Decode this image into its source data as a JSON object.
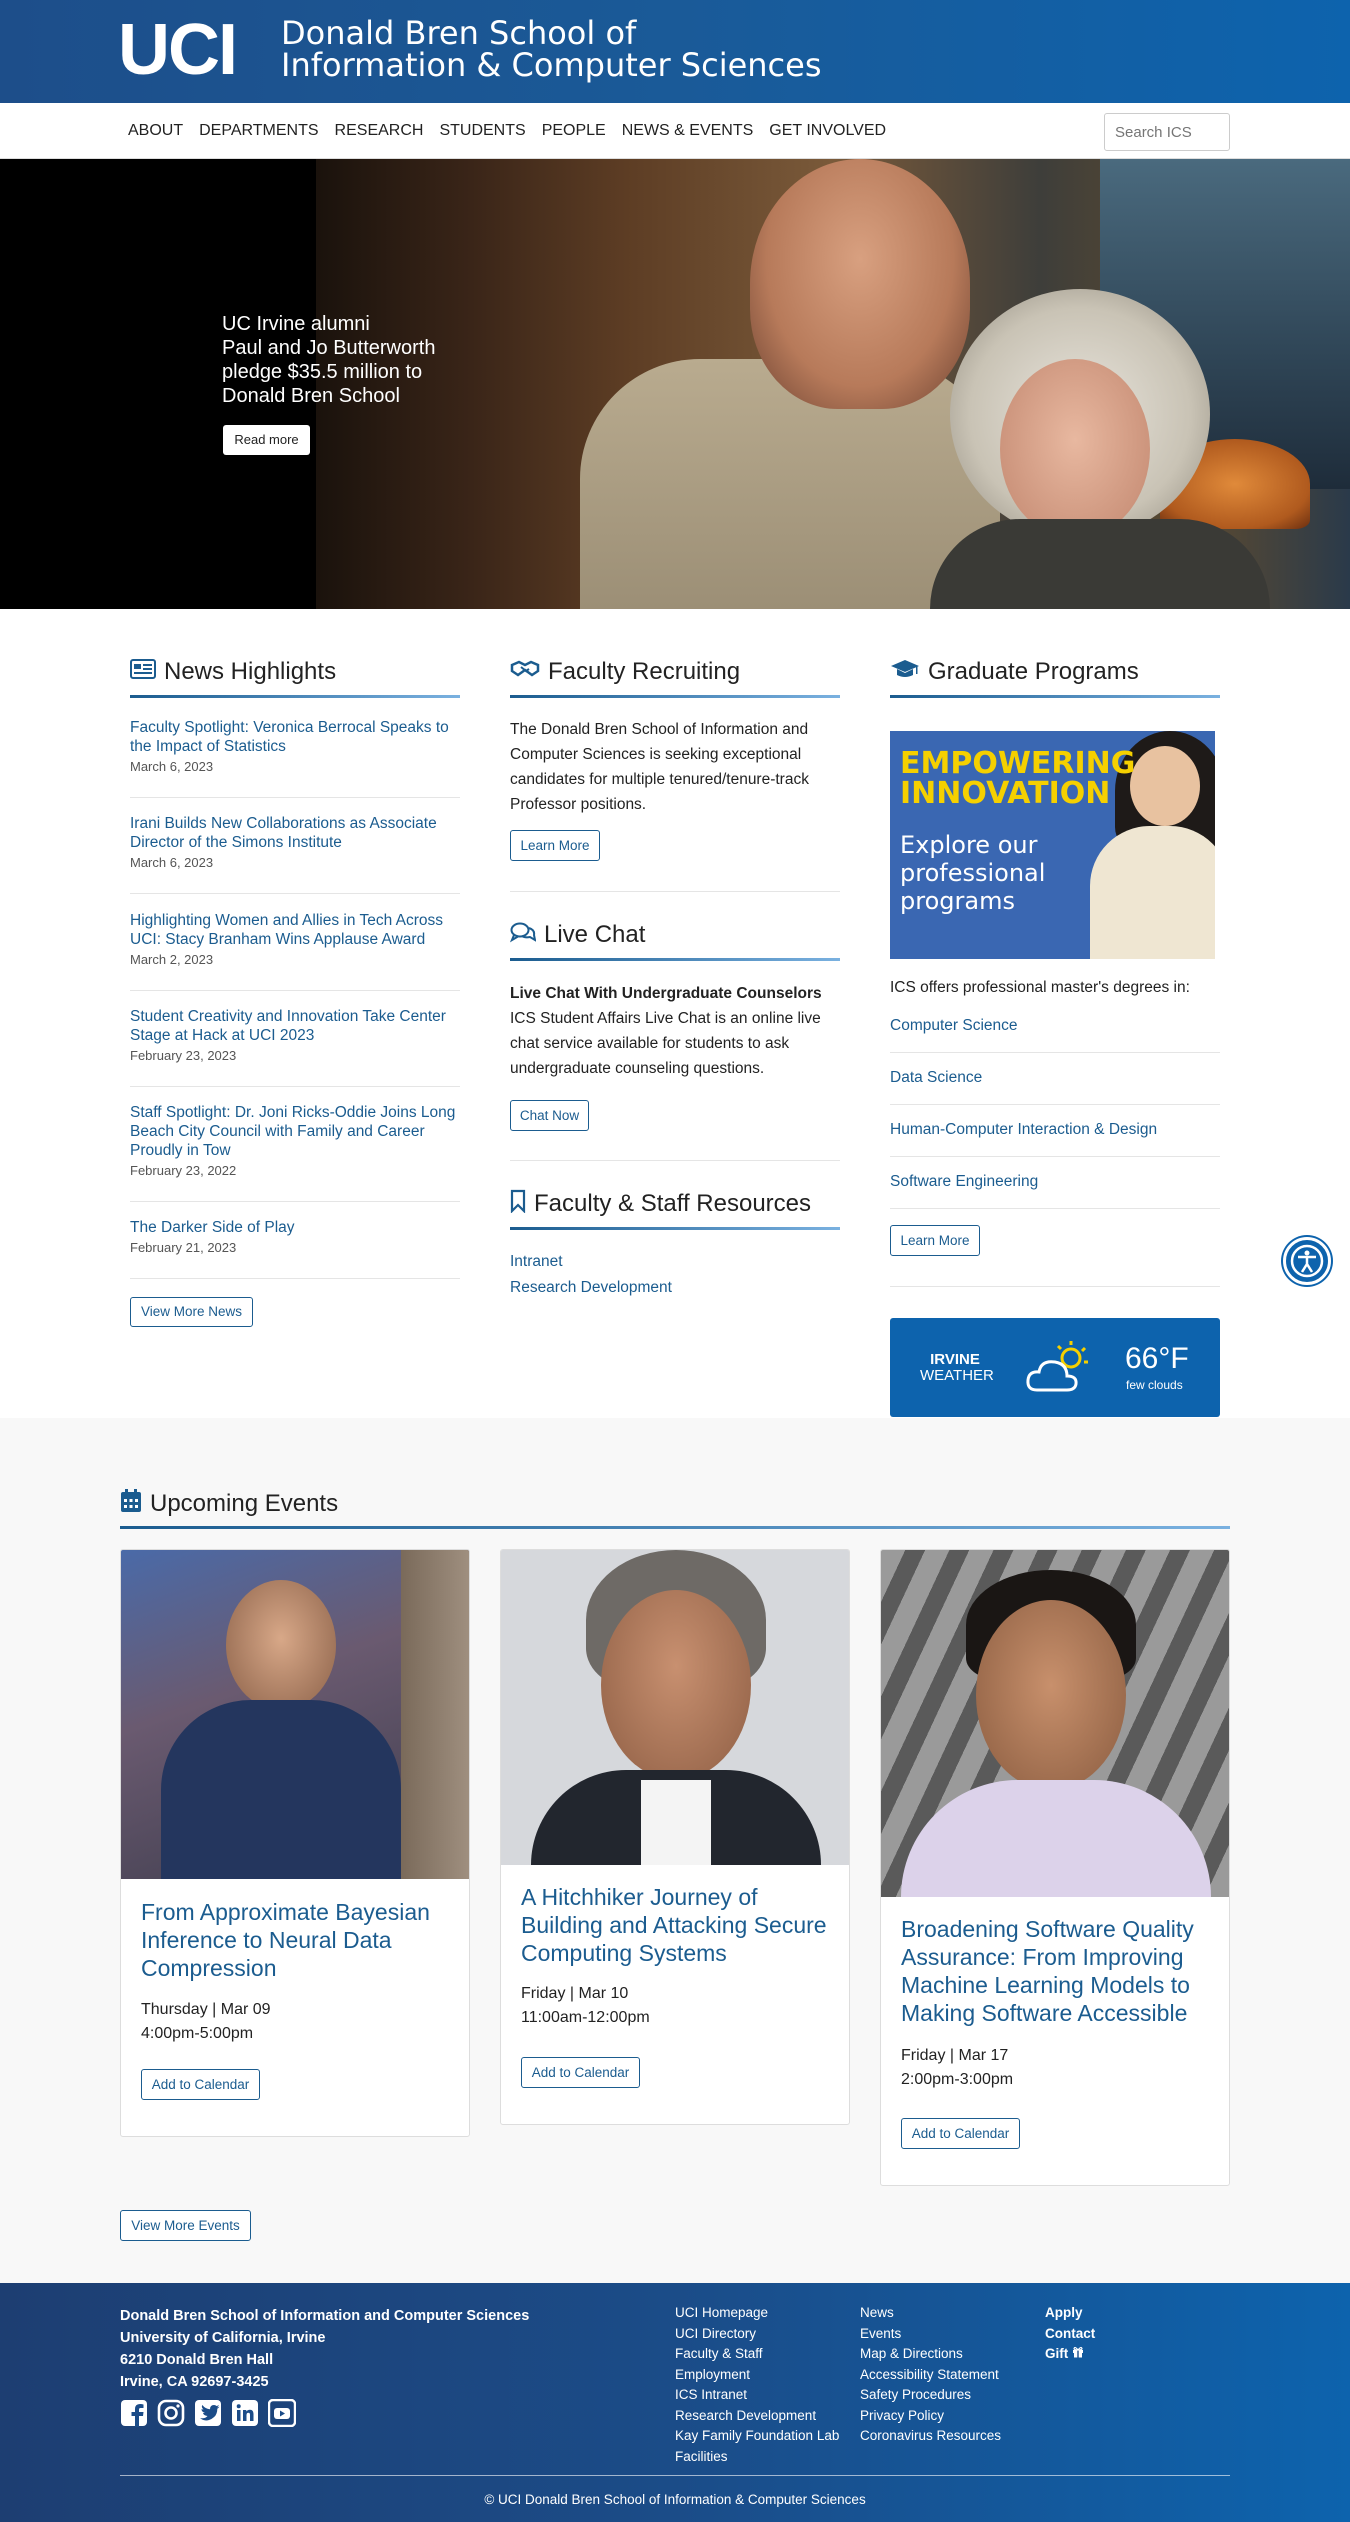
{
  "header": {
    "logo": "UCI",
    "school_line1": "Donald Bren School of",
    "school_line2": "Information & Computer Sciences"
  },
  "nav": {
    "items": [
      "ABOUT",
      "DEPARTMENTS",
      "RESEARCH",
      "STUDENTS",
      "PEOPLE",
      "NEWS & EVENTS",
      "GET INVOLVED"
    ],
    "search_placeholder": "Search ICS"
  },
  "hero": {
    "line1": "UC Irvine alumni",
    "line2": "Paul and Jo Butterworth",
    "line3": "pledge $35.5 million to",
    "line4": "Donald Bren School",
    "button": "Read more"
  },
  "news": {
    "title": "News Highlights",
    "items": [
      {
        "title": "Faculty Spotlight: Veronica Berrocal Speaks to the Impact of Statistics",
        "date": "March 6, 2023"
      },
      {
        "title": "Irani Builds New Collaborations as Associate Director of the Simons Institute",
        "date": "March 6, 2023"
      },
      {
        "title": "Highlighting Women and Allies in Tech Across UCI: Stacy Branham Wins Applause Award",
        "date": "March 2, 2023"
      },
      {
        "title": "Student Creativity and Innovation Take Center Stage at Hack at UCI 2023",
        "date": "February 23, 2023"
      },
      {
        "title": "Staff Spotlight: Dr. Joni Ricks-Oddie Joins Long Beach City Council with Family and Career Proudly in Tow",
        "date": "February 23, 2022"
      },
      {
        "title": "The Darker Side of Play",
        "date": "February 21, 2023"
      }
    ],
    "more_button": "View More News"
  },
  "recruiting": {
    "title": "Faculty Recruiting",
    "text": "The Donald Bren School of Information and Computer Sciences is seeking exceptional candidates for multiple tenured/tenure-track Professor positions.",
    "button": "Learn More"
  },
  "chat": {
    "title": "Live Chat",
    "heading": "Live Chat With Undergraduate Counselors",
    "text": "ICS Student Affairs Live Chat is an online live chat service available for students to ask undergraduate counseling questions.",
    "button": "Chat Now"
  },
  "resources": {
    "title": "Faculty & Staff Resources",
    "links": [
      "Intranet",
      "Research Development"
    ]
  },
  "grad": {
    "title": "Graduate Programs",
    "banner_line1": "EMPOWERING",
    "banner_line2": "INNOVATION",
    "banner_line3": "Explore our",
    "banner_line4": "professional",
    "banner_line5": "programs",
    "intro": "ICS offers professional master's degrees in:",
    "programs": [
      "Computer Science",
      "Data Science",
      "Human-Computer Interaction & Design",
      "Software Engineering"
    ],
    "button": "Learn More"
  },
  "weather": {
    "city": "IRVINE",
    "label": "WEATHER",
    "temp": "66°F",
    "desc": "few clouds"
  },
  "events": {
    "title": "Upcoming Events",
    "items": [
      {
        "title": "From Approximate Bayesian Inference to Neural Data Compression",
        "day": "Thursday | Mar 09",
        "time": "4:00pm-5:00pm",
        "button": "Add to Calendar"
      },
      {
        "title": "A Hitchhiker Journey of Building and Attacking Secure Computing Systems",
        "day": "Friday | Mar 10",
        "time": "11:00am-12:00pm",
        "button": "Add to Calendar"
      },
      {
        "title": "Broadening Software Quality Assurance: From Improving Machine Learning Models to Making Software Accessible",
        "day": "Friday | Mar 17",
        "time": "2:00pm-3:00pm",
        "button": "Add to Calendar"
      }
    ],
    "more_button": "View More Events"
  },
  "footer": {
    "address": [
      "Donald Bren School of Information and Computer Sciences",
      "University of California, Irvine",
      "6210 Donald Bren Hall",
      "Irvine, CA 92697-3425"
    ],
    "col1": [
      "UCI Homepage",
      "UCI Directory",
      "Faculty & Staff",
      "Employment",
      "ICS Intranet",
      "Research Development",
      "Kay Family Foundation Lab",
      "Facilities"
    ],
    "col2": [
      "News",
      "Events",
      "Map & Directions",
      "Accessibility Statement",
      "Safety Procedures",
      "Privacy Policy",
      "Coronavirus Resources"
    ],
    "col3": [
      "Apply",
      "Contact",
      "Gift"
    ],
    "copyright": "© UCI Donald Bren School of Information & Computer Sciences"
  }
}
